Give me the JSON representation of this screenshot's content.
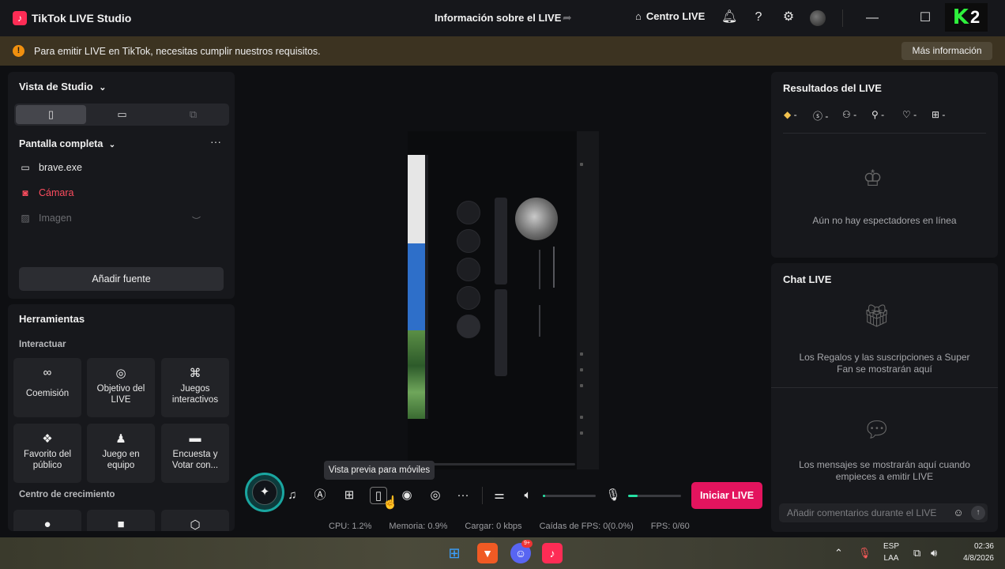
{
  "app": {
    "title": "TikTok LIVE Studio",
    "live_info": "Información sobre el LIVE",
    "centro_live": "Centro LIVE"
  },
  "banner": {
    "text": "Para emitir LIVE en TikTok, necesitas cumplir nuestros requisitos.",
    "button": "Más información"
  },
  "studio": {
    "title": "Vista de Studio",
    "scene": "Pantalla completa",
    "sources": [
      {
        "label": "brave.exe",
        "icon": "window-icon"
      },
      {
        "label": "Cámara",
        "icon": "camera-icon"
      },
      {
        "label": "Imagen",
        "icon": "image-icon"
      }
    ],
    "add_source": "Añadir fuente"
  },
  "tools": {
    "title": "Herramientas",
    "interact_label": "Interactuar",
    "items": [
      {
        "label": "Coemisión",
        "icon": "link-icon"
      },
      {
        "label": "Objetivo del LIVE",
        "icon": "target-icon"
      },
      {
        "label": "Juegos interactivos",
        "icon": "gamepad-icon"
      },
      {
        "label": "Favorito del público",
        "icon": "gift-icon"
      },
      {
        "label": "Juego en equipo",
        "icon": "team-icon"
      },
      {
        "label": "Encuesta y Votar con...",
        "icon": "poll-icon"
      }
    ],
    "growth_label": "Centro de crecimiento"
  },
  "preview": {
    "tooltip": "Vista previa para móviles"
  },
  "controls": {
    "start_live": "Iniciar LIVE",
    "speaker_level": 0.05,
    "mic_level": 0.18
  },
  "stats": {
    "cpu": "CPU:  1.2%",
    "memory": "Memoria:  0.9%",
    "load": "Cargar:  0 kbps",
    "fps_drops": "Caídas de FPS:  0(0.0%)",
    "fps": "FPS:  0/60"
  },
  "results": {
    "title": "Resultados del LIVE",
    "metrics": [
      "-",
      "-",
      "-",
      "-",
      "-",
      "-"
    ],
    "empty": "Aún no hay espectadores en línea"
  },
  "chat": {
    "title": "Chat LIVE",
    "gifts_empty": "Los Regalos y las suscripciones a Super Fan se mostrarán aquí",
    "messages_empty": "Los mensajes se mostrarán aquí cuando empieces a emitir LIVE",
    "input_placeholder": "Añadir comentarios durante el LIVE"
  },
  "taskbar": {
    "discord_badge": "9+",
    "lang_1": "ESP",
    "lang_2": "LAA",
    "time": "02:36",
    "date": "4/8/2026"
  },
  "colors": {
    "accent": "#e3145e",
    "warning": "#f0900f",
    "level": "#25e0a3"
  }
}
